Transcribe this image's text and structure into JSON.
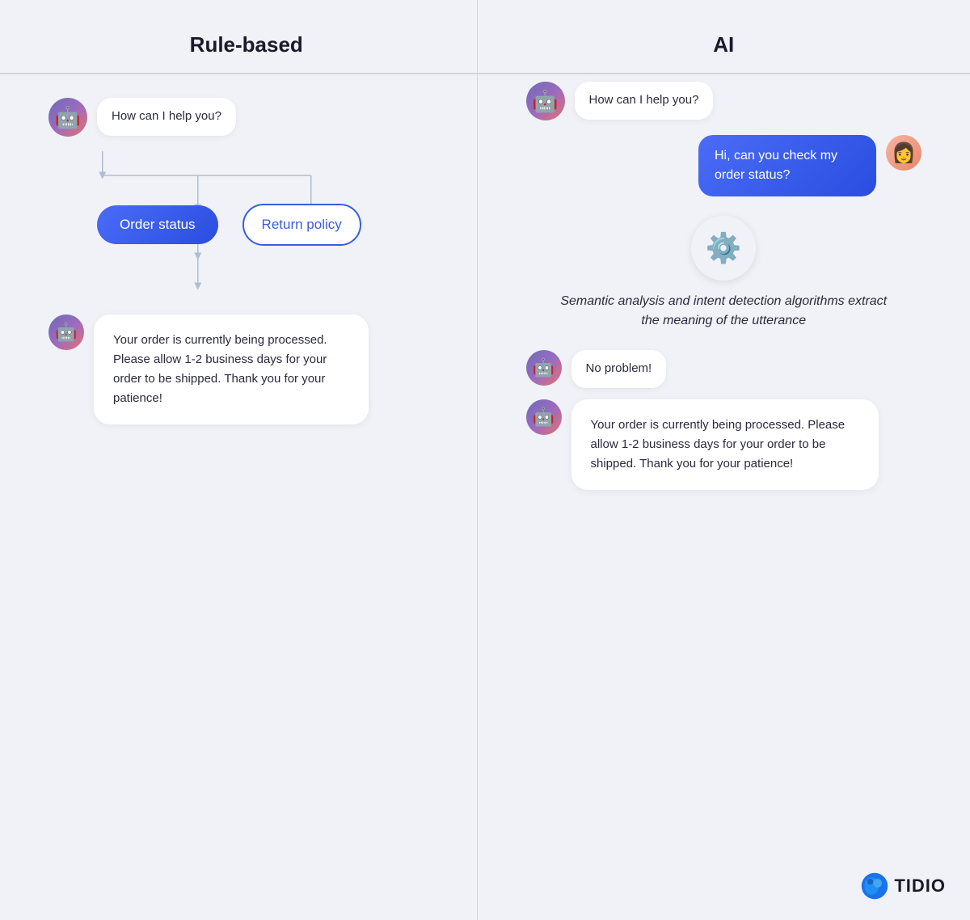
{
  "left": {
    "header": "Rule-based",
    "greeting_bubble": "How can I help you?",
    "option1": "Order status",
    "option2": "Return policy",
    "response": "Your order is currently being processed. Please allow 1-2 business days for your order to be shipped. Thank you for your patience!"
  },
  "right": {
    "header": "AI",
    "greeting_bubble": "How can I help you?",
    "user_message": "Hi, can you check my order status?",
    "semantic_text": "Semantic analysis and intent detection algorithms extract the meaning of the utterance",
    "bot_reply1": "No problem!",
    "bot_reply2": "Your order is currently being processed. Please allow 1-2 business days for your order to be shipped. Thank you for your patience!"
  },
  "brand": {
    "name": "TIDIO"
  }
}
